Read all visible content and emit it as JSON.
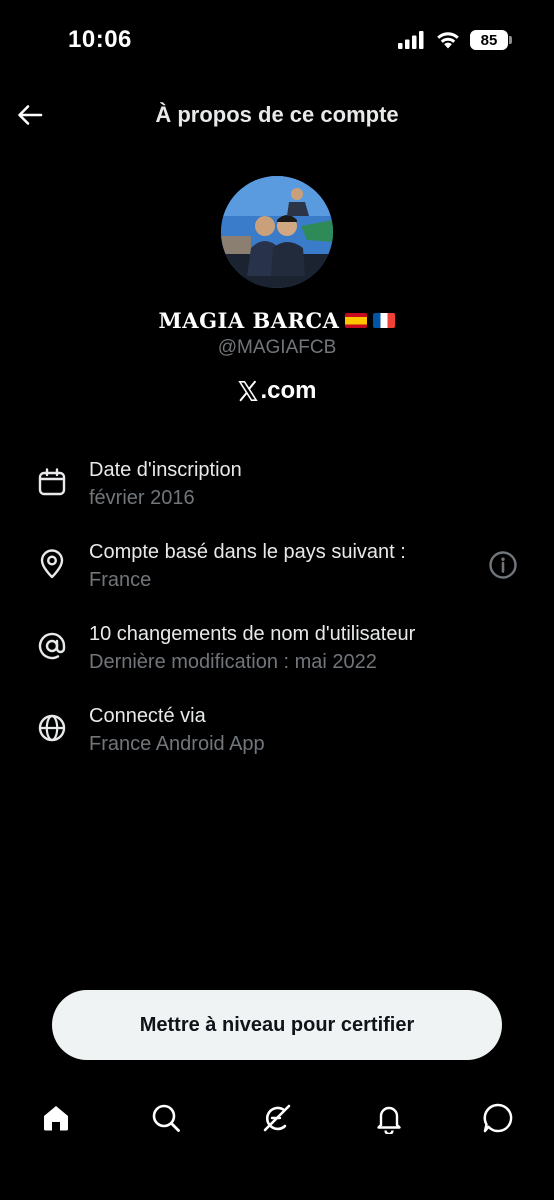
{
  "status_bar": {
    "time": "10:06",
    "battery": "85"
  },
  "header": {
    "title": "À propos de ce compte"
  },
  "profile": {
    "display_name": "MAGIA BARCA",
    "handle": "@MAGIAFCB",
    "site_suffix": ".com"
  },
  "info": [
    {
      "title": "Date d'inscription",
      "sub": "février 2016",
      "icon": "calendar-icon"
    },
    {
      "title": "Compte basé dans le pays suivant :",
      "sub": "France",
      "icon": "location-pin-icon"
    },
    {
      "title": "10 changements de nom d'utilisateur",
      "sub": "Dernière modification : mai 2022",
      "icon": "at-sign-icon"
    },
    {
      "title": "Connecté via",
      "sub": "France Android App",
      "icon": "globe-icon"
    }
  ],
  "cta": {
    "label": "Mettre à niveau pour certifier"
  },
  "colors": {
    "background": "#000000",
    "primary_text": "#e7e9ea",
    "secondary_text": "#71767b",
    "button_bg": "#eff3f4"
  }
}
